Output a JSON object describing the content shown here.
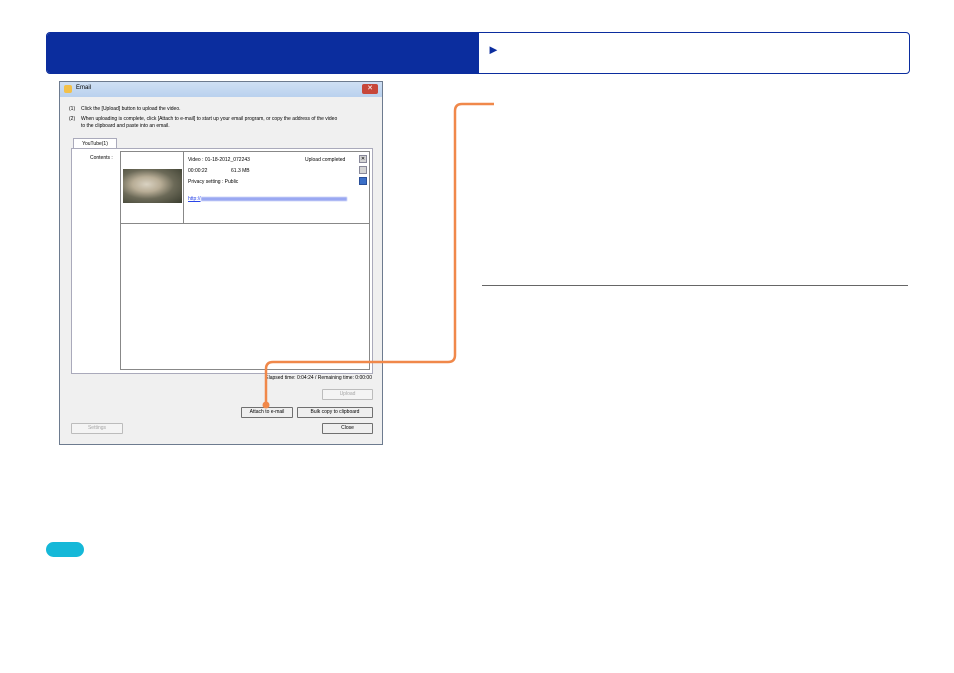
{
  "banner": {
    "arrow": "►"
  },
  "window": {
    "title": "Email",
    "close": "✕",
    "instructions": [
      {
        "num": "(1)",
        "text": "Click the [Upload] button to upload the video."
      },
      {
        "num": "(2)",
        "text": "When uploading is complete, click [Attach to e-mail] to start up your email program, or copy the address of the video"
      }
    ],
    "instruction_cont": "to the clipboard and paste into an email.",
    "tab": "YouTube(1)",
    "contents_label": "Contents :",
    "item": {
      "name": "Video : 01-18-2012_072243",
      "status": "Upload completed",
      "duration": "00:00:22",
      "size": "61.3 MB",
      "privacy": "Privacy setting : Public",
      "link_prefix": "http://"
    },
    "elapsed": "Elapsed time: 0:04:24 / Remaining time: 0:00:00",
    "buttons": {
      "upload": "Upload",
      "attach": "Attach to e-mail",
      "bulk_copy": "Bulk copy to clipboard",
      "settings": "Settings",
      "close": "Close"
    }
  },
  "colors": {
    "banner": "#0b2d9e",
    "callout": "#f0884a",
    "pill": "#15b8d8"
  }
}
